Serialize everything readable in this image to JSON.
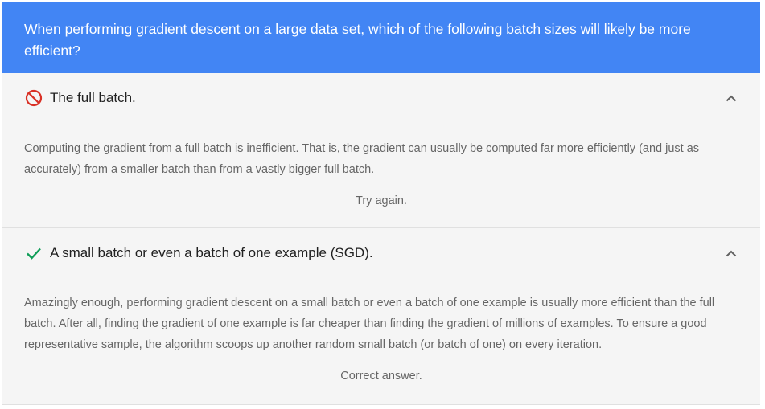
{
  "question": "When performing gradient descent on a large data set, which of the following batch sizes will likely be more efficient?",
  "answers": [
    {
      "text": "The full batch.",
      "status_icon": "prohibited-icon",
      "status_color": "#d93025",
      "explanation": "Computing the gradient from a full batch is inefficient. That is, the gradient can usually be computed far more efficiently (and just as accurately) from a smaller batch than from a vastly bigger full batch.",
      "feedback": "Try again.",
      "toggle_icon": "chevron-up-icon"
    },
    {
      "text": "A small batch or even a batch of one example (SGD).",
      "status_icon": "checkmark-icon",
      "status_color": "#0f9d58",
      "explanation": "Amazingly enough, performing gradient descent on a small batch or even a batch of one example is usually more efficient than the full batch. After all, finding the gradient of one example is far cheaper than finding the gradient of millions of examples. To ensure a good representative sample, the algorithm scoops up another random small batch (or batch of one) on every iteration.",
      "feedback": "Correct answer.",
      "toggle_icon": "chevron-up-icon"
    }
  ],
  "colors": {
    "header_bg": "#4285f4",
    "panel_bg": "#f5f5f5",
    "body_text": "#666666"
  }
}
